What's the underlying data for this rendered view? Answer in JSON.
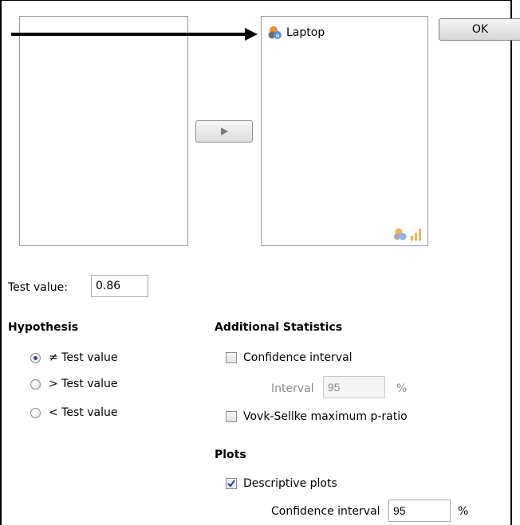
{
  "variables": {
    "source_items": [],
    "target_items": [
      {
        "name": "Laptop",
        "icon": "nominal-variable-icon"
      }
    ],
    "target_hint_icons": [
      "nominal-variable-icon",
      "scale-variable-icon"
    ]
  },
  "buttons": {
    "ok_label": "OK",
    "move_icon": "right-triangle-icon"
  },
  "test_value": {
    "label": "Test value:",
    "value": "0.86"
  },
  "hypothesis": {
    "title": "Hypothesis",
    "options": [
      {
        "label": "≠ Test value",
        "selected": true
      },
      {
        "label": "> Test value",
        "selected": false
      },
      {
        "label": "< Test value",
        "selected": false
      }
    ]
  },
  "additional_statistics": {
    "title": "Additional Statistics",
    "confidence_interval_label": "Confidence interval",
    "confidence_interval_checked": false,
    "interval_label": "Interval",
    "interval_value": "95",
    "interval_unit": "%",
    "vovk_label": "Vovk-Sellke maximum p-ratio",
    "vovk_checked": false
  },
  "plots": {
    "title": "Plots",
    "descriptive_label": "Descriptive plots",
    "descriptive_checked": true,
    "ci_label": "Confidence interval",
    "ci_value": "95",
    "ci_unit": "%"
  },
  "colors": {
    "arrow": "#000000",
    "radio_selected": "#1f4f9c",
    "nominal_icon_orange": "#e8902a",
    "nominal_icon_blue": "#5b8fd6",
    "nominal_icon_grey": "#6f6f6f"
  }
}
